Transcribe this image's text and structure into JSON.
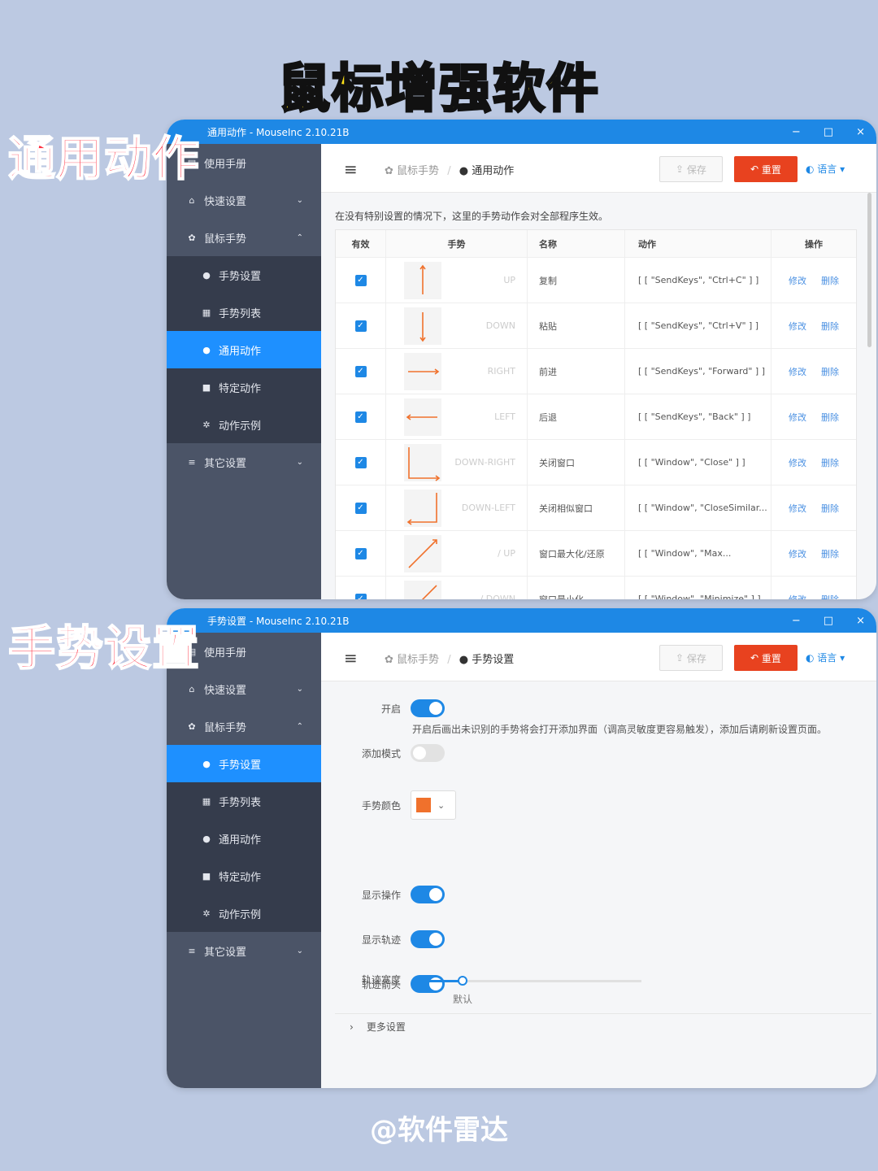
{
  "page": {
    "main_title": "鼠标增强软件",
    "footer": "@软件雷达"
  },
  "labels": {
    "top": "通用动作",
    "bottom": "手势设置"
  },
  "win1": {
    "title": "通用动作 - MouseInc 2.10.21B",
    "breadcrumb": {
      "parent": "鼠标手势",
      "sep": "/",
      "current": "通用动作"
    }
  },
  "win2": {
    "title": "手势设置 - MouseInc 2.10.21B",
    "breadcrumb": {
      "parent": "鼠标手势",
      "sep": "/",
      "current": "手势设置"
    }
  },
  "window_controls": {
    "min": "−",
    "max": "□",
    "close": "×"
  },
  "toolbar": {
    "save": "保存",
    "reset": "重置",
    "lang": "语言"
  },
  "sidebar": {
    "manual": "使用手册",
    "quick": "快速设置",
    "gesture": "鼠标手势",
    "sub": [
      "手势设置",
      "手势列表",
      "通用动作",
      "特定动作",
      "动作示例"
    ],
    "other": "其它设置"
  },
  "table": {
    "desc": "在没有特别设置的情况下，这里的手势动作会对全部程序生效。",
    "headers": [
      "有效",
      "手势",
      "名称",
      "动作",
      "操作"
    ],
    "edit": "修改",
    "delete": "删除",
    "rows": [
      {
        "gesture": "UP",
        "name": "复制",
        "action": "[ [ \"SendKeys\", \"Ctrl+C\" ] ]",
        "shape": "up"
      },
      {
        "gesture": "DOWN",
        "name": "粘贴",
        "action": "[ [ \"SendKeys\", \"Ctrl+V\" ] ]",
        "shape": "down"
      },
      {
        "gesture": "RIGHT",
        "name": "前进",
        "action": "[ [ \"SendKeys\", \"Forward\" ] ]",
        "shape": "right"
      },
      {
        "gesture": "LEFT",
        "name": "后退",
        "action": "[ [ \"SendKeys\", \"Back\" ] ]",
        "shape": "left"
      },
      {
        "gesture": "DOWN-RIGHT",
        "name": "关闭窗口",
        "action": "[ [ \"Window\", \"Close\" ] ]",
        "shape": "down-right"
      },
      {
        "gesture": "DOWN-LEFT",
        "name": "关闭相似窗口",
        "action": "[ [ \"Window\", \"CloseSimilar...",
        "shape": "down-left"
      },
      {
        "gesture": "/ UP",
        "name": "窗口最大化/还原",
        "action": "[ [ \"Window\", \"Max...",
        "shape": "diag-up"
      },
      {
        "gesture": "/ DOWN",
        "name": "窗口最小化",
        "action": "[ [ \"Window\", \"Minimize\" ] ]",
        "shape": "diag-down"
      }
    ]
  },
  "settings": {
    "enable": "开启",
    "add_mode": "添加模式",
    "add_mode_hint": "开启后画出未识别的手势将会打开添加界面（调高灵敏度更容易触发），添加后请刷新设置页面。",
    "color": "手势颜色",
    "gesture_color": "#f0712c",
    "show_action": "显示操作",
    "show_trail": "显示轨迹",
    "trail_arrow": "轨迹箭头",
    "trail_width": "轨迹宽度",
    "trail_width_default": "默认",
    "trail_width_level": 0.22,
    "more": "更多设置"
  },
  "colors": {
    "accent": "#1e88e5",
    "danger": "#e8421f",
    "sidebar": "#4b5467",
    "gesture_stroke": "#f0712c"
  }
}
